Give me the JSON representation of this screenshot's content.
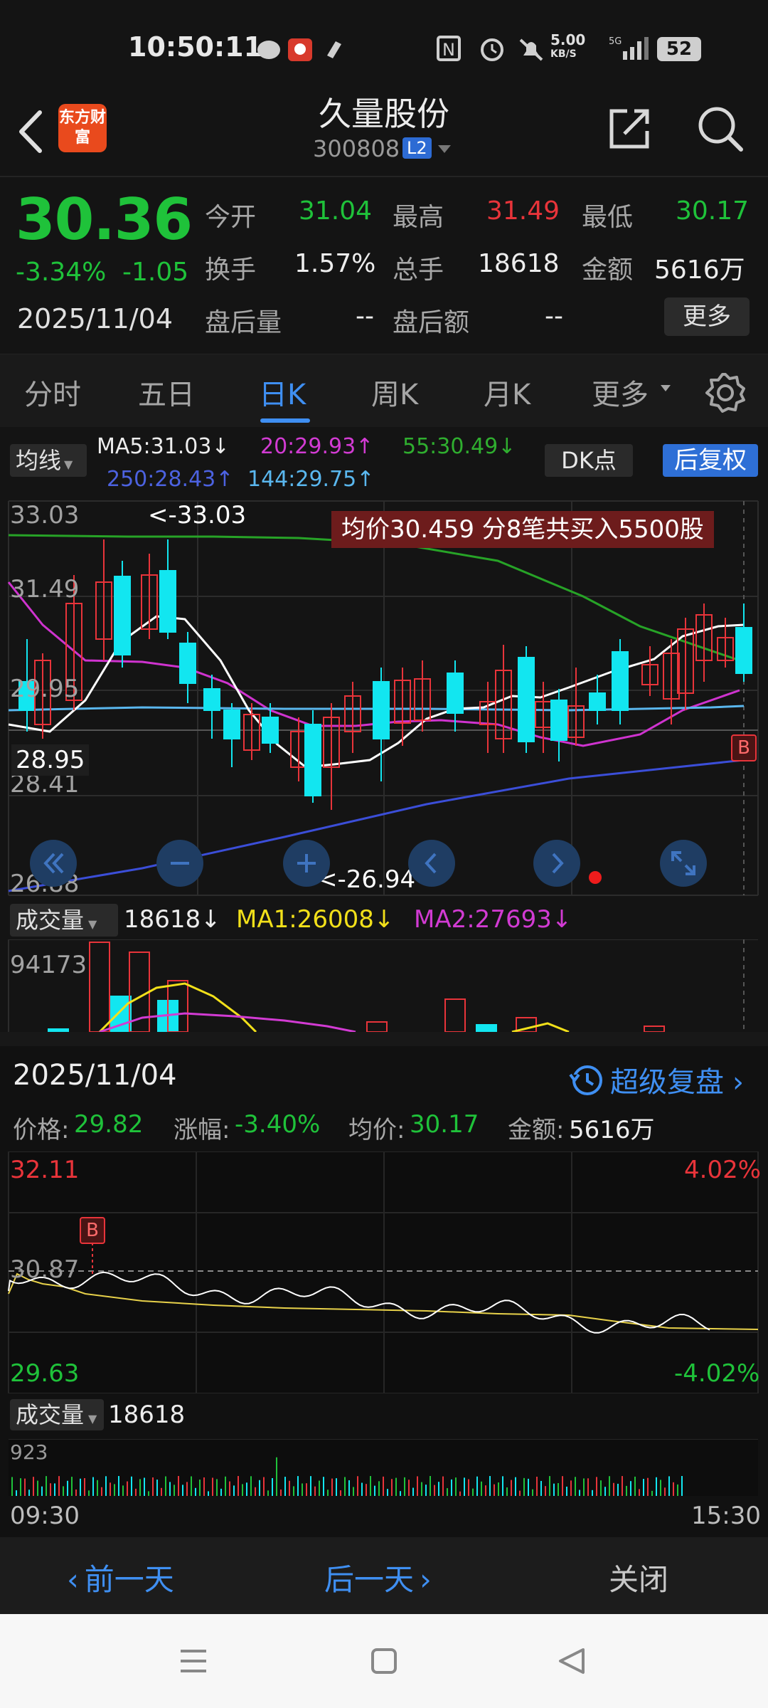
{
  "status_bar": {
    "time": "10:50:11",
    "network_speed": "5.00",
    "network_unit": "KB/S",
    "battery": "52"
  },
  "header": {
    "app_logo": "东方财富",
    "title": "久量股份",
    "code": "300808",
    "level_badge": "L2"
  },
  "quote": {
    "price": "30.36",
    "change_pct": "-3.34%",
    "change_amt": "-1.05",
    "date": "2025/11/04",
    "fields": [
      {
        "label": "今开",
        "value": "31.04",
        "color": "green"
      },
      {
        "label": "最高",
        "value": "31.49",
        "color": "red"
      },
      {
        "label": "最低",
        "value": "30.17",
        "color": "green"
      },
      {
        "label": "换手",
        "value": "1.57%",
        "color": "white"
      },
      {
        "label": "总手",
        "value": "18618",
        "color": "white"
      },
      {
        "label": "金额",
        "value": "5616万",
        "color": "white"
      },
      {
        "label": "盘后量",
        "value": "--",
        "color": "white"
      },
      {
        "label": "盘后额",
        "value": "--",
        "color": "white"
      }
    ],
    "more_label": "更多"
  },
  "tabs": [
    "分时",
    "五日",
    "日K",
    "周K",
    "月K",
    "更多"
  ],
  "active_tab": "日K",
  "indicators": {
    "ma_button": "均线",
    "ma5": "MA5:31.03↓",
    "ma20": "20:29.93↑",
    "ma55": "55:30.49↓",
    "ma250": "250:28.43↑",
    "ma144": "144:29.75↑",
    "dk_button": "DK点",
    "fq_button": "后复权"
  },
  "kchart": {
    "y_labels": [
      "33.03",
      "31.49",
      "29.95",
      "28.41",
      "26.88"
    ],
    "high_marker": "<-33.03",
    "low_marker": "<-26.94",
    "price_tag": "28.95",
    "avg_banner": "均价30.459  分8笔共买入5500股",
    "b_marker": "B"
  },
  "volume": {
    "button": "成交量",
    "value": "18618↓",
    "ma1": "MA1:26008↓",
    "ma2": "MA2:27693↓",
    "max_label": "94173"
  },
  "intraday": {
    "date": "2025/11/04",
    "replay_label": "超级复盘",
    "stats": [
      {
        "label": "价格:",
        "value": "29.82"
      },
      {
        "label": "涨幅:",
        "value": "-3.40%"
      },
      {
        "label": "均价:",
        "value": "30.17"
      },
      {
        "label": "金额:",
        "value": "5616万"
      }
    ],
    "top_price": "32.11",
    "mid_price": "30.87",
    "bottom_price": "29.63",
    "top_pct": "4.02%",
    "bottom_pct": "-4.02%",
    "b_marker": "B",
    "vol_button": "成交量",
    "vol_value": "18618",
    "vol_max": "923",
    "time_start": "09:30",
    "time_end": "15:30"
  },
  "bottom_bar": {
    "prev": "前一天",
    "next": "后一天",
    "close": "关闭"
  },
  "colors": {
    "up": "#e8343a",
    "down": "#1fc23a",
    "accent": "#3f8ff2",
    "candle_down": "#12e6f0"
  }
}
